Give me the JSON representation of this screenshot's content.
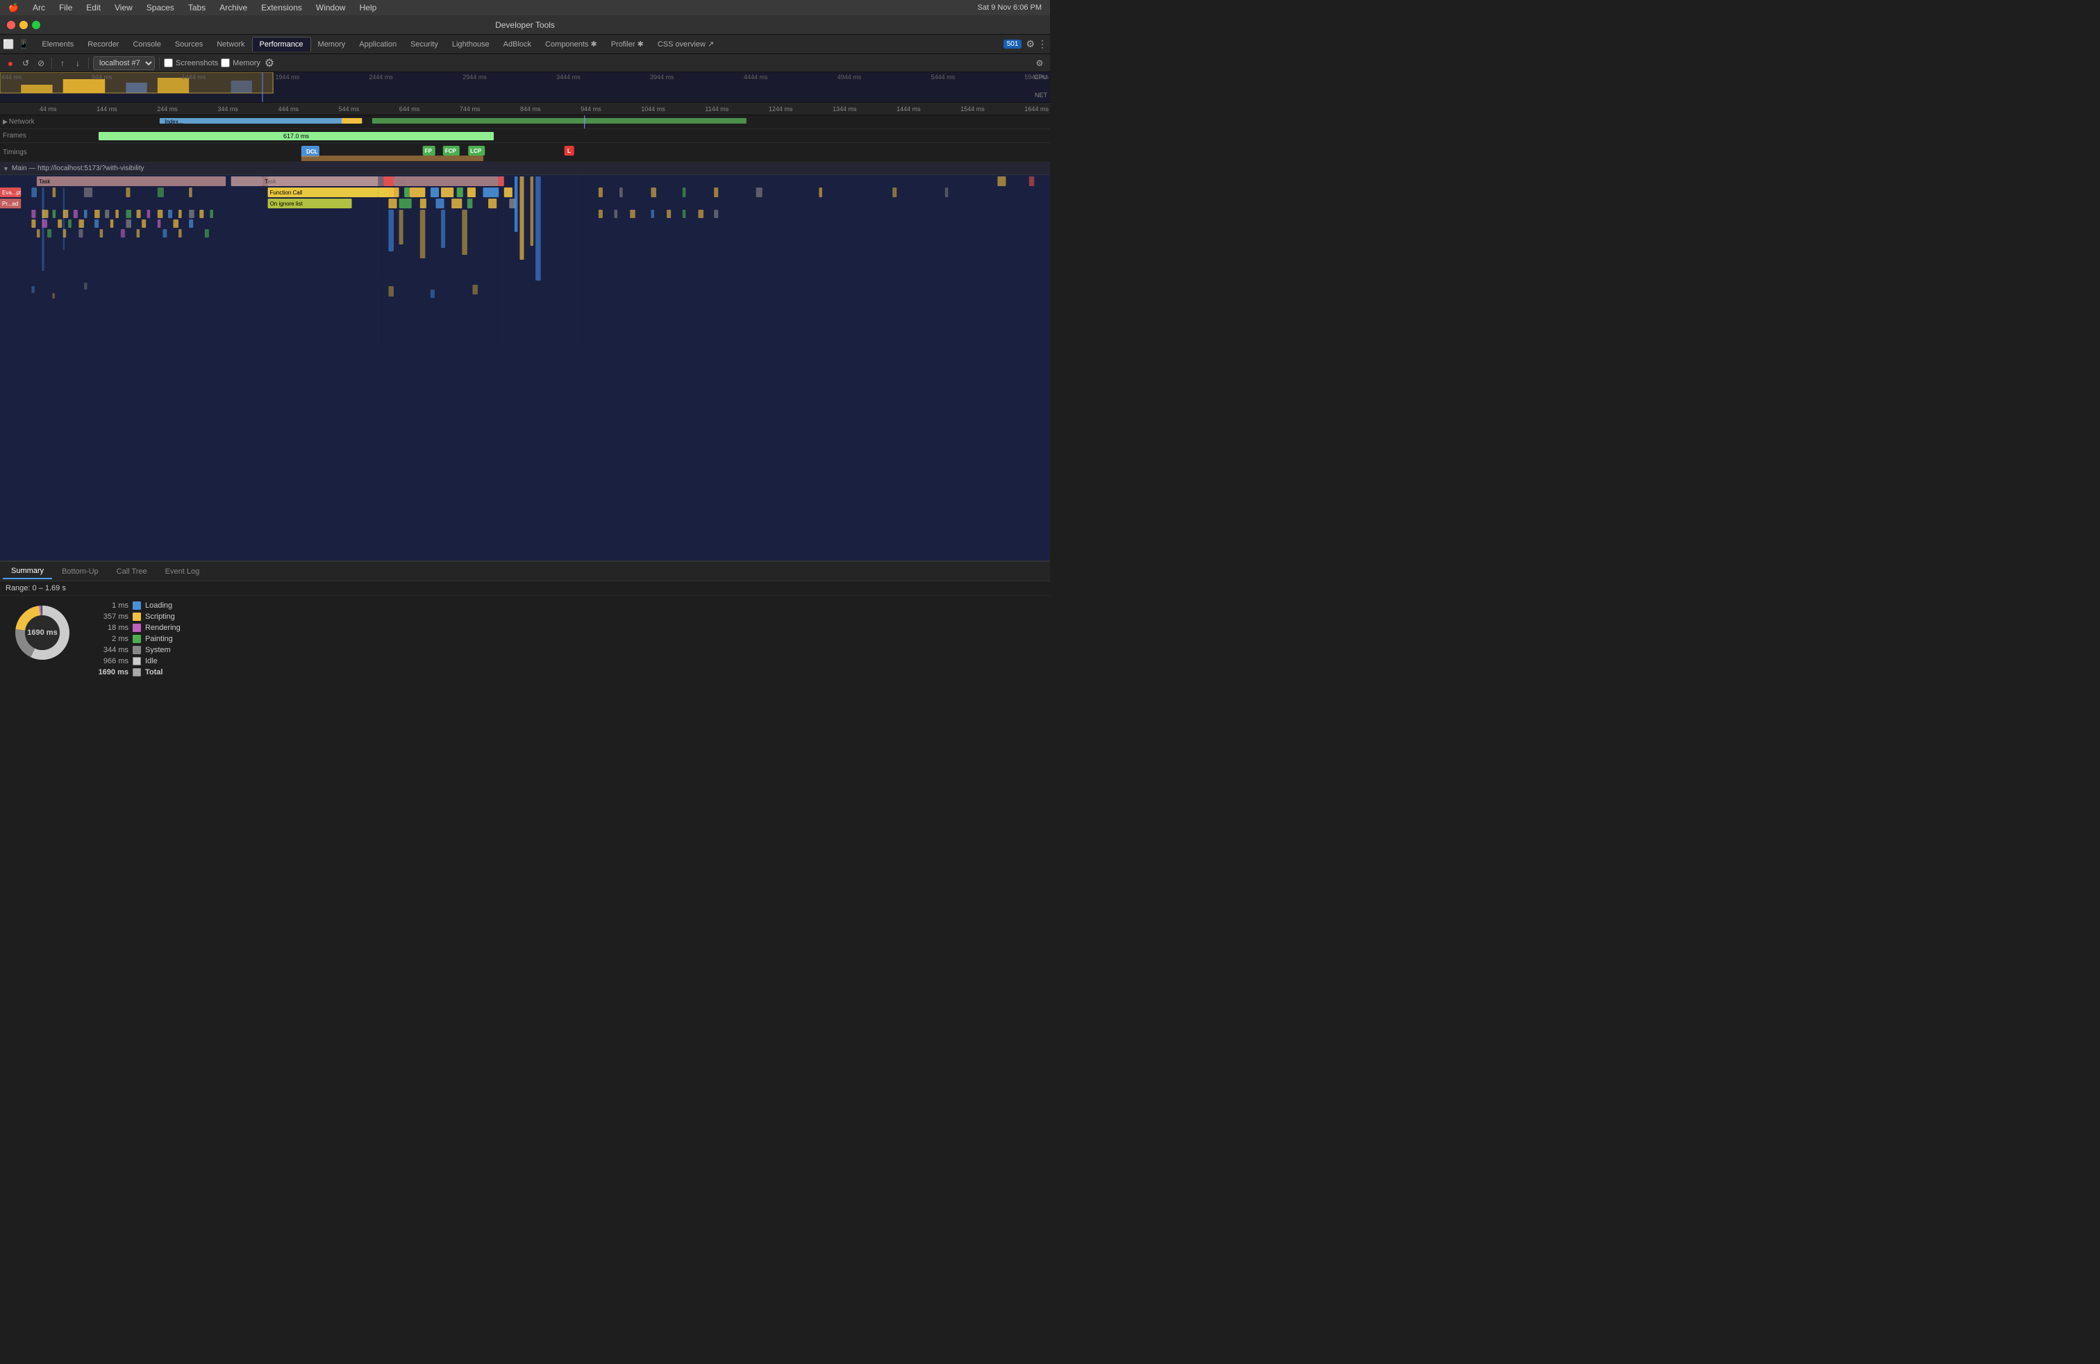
{
  "macbar": {
    "apple": "🍎",
    "items": [
      "Arc",
      "File",
      "Edit",
      "View",
      "Spaces",
      "Tabs",
      "Archive",
      "Extensions",
      "Window",
      "Help"
    ],
    "time": "Sat 9 Nov  6:06 PM"
  },
  "titlebar": {
    "title": "Developer Tools"
  },
  "tabs": [
    {
      "label": "Elements",
      "active": false
    },
    {
      "label": "Recorder",
      "active": false
    },
    {
      "label": "Console",
      "active": false
    },
    {
      "label": "Sources",
      "active": false
    },
    {
      "label": "Network",
      "active": false
    },
    {
      "label": "Performance",
      "active": true
    },
    {
      "label": "Memory",
      "active": false
    },
    {
      "label": "Application",
      "active": false
    },
    {
      "label": "Security",
      "active": false
    },
    {
      "label": "Lighthouse",
      "active": false
    },
    {
      "label": "AdBlock",
      "active": false
    },
    {
      "label": "Components ✱",
      "active": false
    },
    {
      "label": "Profiler ✱",
      "active": false
    },
    {
      "label": "CSS overview ↗",
      "active": false
    }
  ],
  "controls": {
    "record_label": "●",
    "reload_label": "↺",
    "clear_label": "⊘",
    "upload_label": "↑",
    "download_label": "↓",
    "session_label": "localhost #7",
    "screenshots_label": "Screenshots",
    "memory_label": "Memory",
    "settings_label": "⚙",
    "count": "501"
  },
  "overview": {
    "time_markers": [
      "44 ms",
      "144 ms",
      "244 ms",
      "344 ms",
      "444 ms",
      "544 ms",
      "644 ms",
      "744 ms",
      "844 ms",
      "944 ms",
      "1044 ms",
      "1144 ms",
      "1244 ms",
      "1344 ms",
      "1444 ms",
      "1544 ms",
      "1644 ms"
    ],
    "top_markers": [
      "444 ms",
      "944 ms",
      "1444 ms",
      "1944 ms",
      "2444 ms",
      "2944 ms",
      "3444 ms",
      "3944 ms",
      "4444 ms",
      "4944 ms",
      "5444 ms",
      "5944 ms"
    ],
    "cpu_label": "CPU",
    "net_label": "NET"
  },
  "tracks": {
    "network_label": "Network",
    "frames_label": "Frames",
    "frames_duration": "617.0 ms",
    "timings_label": "Timings",
    "timing_markers": [
      {
        "label": "DCL",
        "color": "#4A90D9",
        "left_pct": 26
      },
      {
        "label": "FP",
        "color": "#4CAF50",
        "left_pct": 39
      },
      {
        "label": "FCP",
        "color": "#4CAF50",
        "left_pct": 41
      },
      {
        "label": "LCP",
        "color": "#4CAF50",
        "left_pct": 43
      },
      {
        "label": "L",
        "color": "#e53935",
        "left_pct": 52
      }
    ]
  },
  "main_section": {
    "label": "Main — http://localhost:5173/?with-visibility",
    "task_bars": [
      {
        "label": "Task",
        "left_pct": 0,
        "width_pct": 20,
        "color": "#c8a0a0"
      },
      {
        "label": "Task",
        "left_pct": 22,
        "width_pct": 22,
        "color": "#c8a0a0"
      },
      {
        "label": "Task",
        "left_pct": 25,
        "width_pct": 14,
        "color": "#c8a0a0"
      },
      {
        "label": "Function Call",
        "left_pct": 25.5,
        "width_pct": 12,
        "color": "#e8c840"
      },
      {
        "label": "On ignore list",
        "left_pct": 25.5,
        "width_pct": 8,
        "color": "#b0b030"
      }
    ]
  },
  "bottom_panel": {
    "tabs": [
      "Summary",
      "Bottom-Up",
      "Call Tree",
      "Event Log"
    ],
    "active_tab": "Summary",
    "range": "Range: 0 – 1.69 s",
    "total_ms": "1690 ms",
    "entries": [
      {
        "value": "1 ms",
        "color": "#4a90d9",
        "label": "Loading"
      },
      {
        "value": "357 ms",
        "color": "#f0c040",
        "label": "Scripting"
      },
      {
        "value": "18 ms",
        "color": "#c060c0",
        "label": "Rendering"
      },
      {
        "value": "2 ms",
        "color": "#4CAF50",
        "label": "Painting"
      },
      {
        "value": "344 ms",
        "color": "#888888",
        "label": "System"
      },
      {
        "value": "966 ms",
        "color": "#cccccc",
        "label": "Idle"
      },
      {
        "value": "1690 ms",
        "color": "#ffffff",
        "label": "Total",
        "bold": true
      }
    ],
    "donut": {
      "center_label": "1690 ms",
      "segments": [
        {
          "color": "#f0c040",
          "pct": 21,
          "label": "Scripting"
        },
        {
          "color": "#888888",
          "pct": 20,
          "label": "System"
        },
        {
          "color": "#cccccc",
          "pct": 57,
          "label": "Idle"
        },
        {
          "color": "#c060c0",
          "pct": 1,
          "label": "Rendering"
        },
        {
          "color": "#4a90d9",
          "pct": 0.1,
          "label": "Loading"
        },
        {
          "color": "#4CAF50",
          "pct": 0.1,
          "label": "Painting"
        }
      ]
    }
  }
}
